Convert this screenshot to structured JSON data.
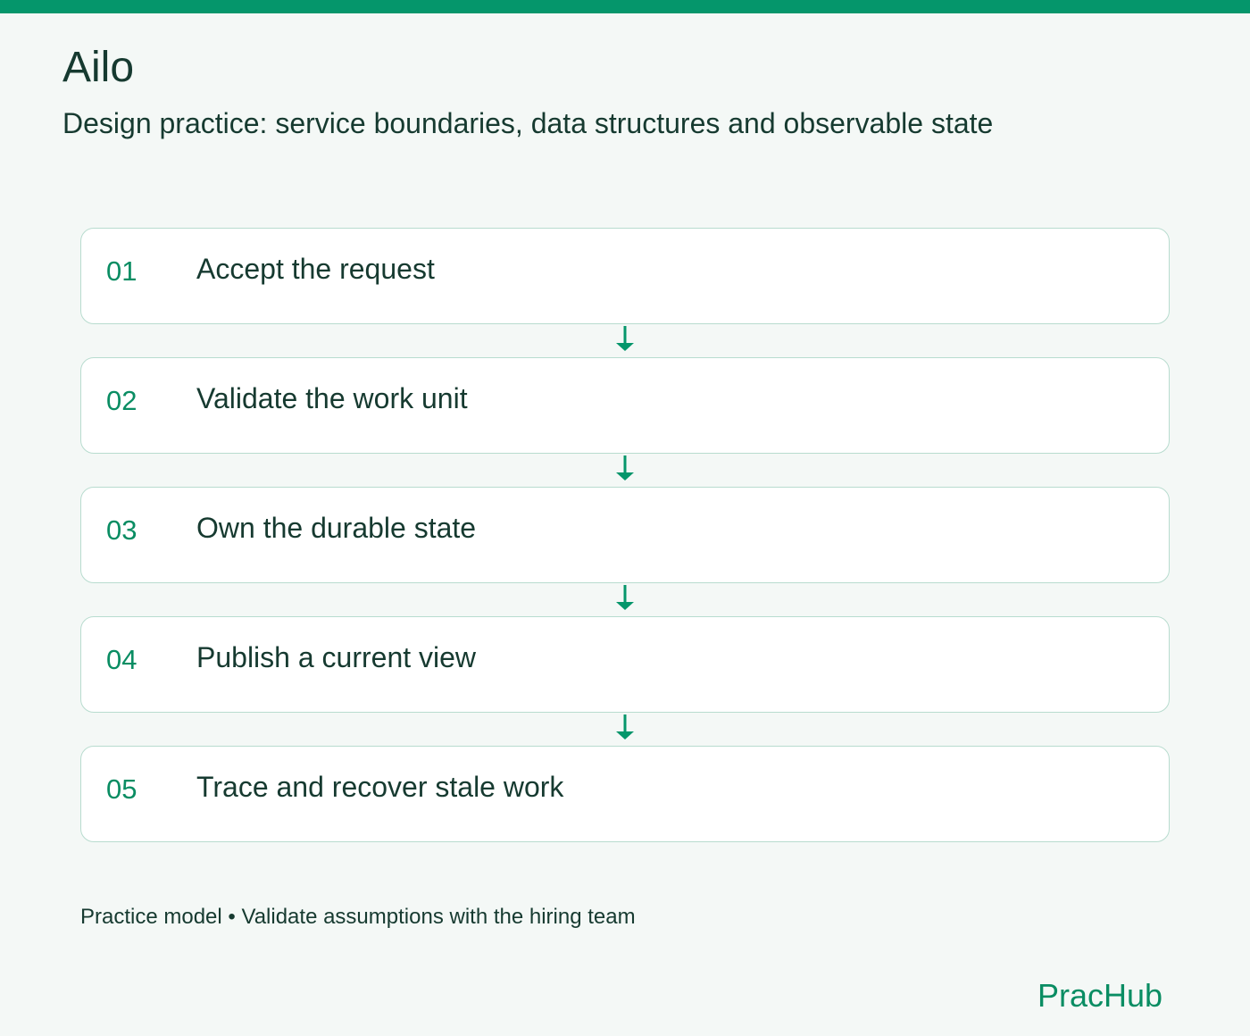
{
  "header": {
    "title": "Ailo",
    "subtitle": "Design practice: service boundaries, data structures and observable state"
  },
  "steps": [
    {
      "number": "01",
      "label": "Accept the request"
    },
    {
      "number": "02",
      "label": "Validate the work unit"
    },
    {
      "number": "03",
      "label": "Own the durable state"
    },
    {
      "number": "04",
      "label": "Publish a current view"
    },
    {
      "number": "05",
      "label": "Trace and recover stale work"
    }
  ],
  "footnote": "Practice model • Validate assumptions with the hiring team",
  "brand": "PracHub",
  "colors": {
    "accent": "#05966b",
    "text": "#163a30",
    "background": "#f4f8f6",
    "card_border": "#b8dccf"
  },
  "icons": {
    "connector": "arrow-down-icon"
  }
}
